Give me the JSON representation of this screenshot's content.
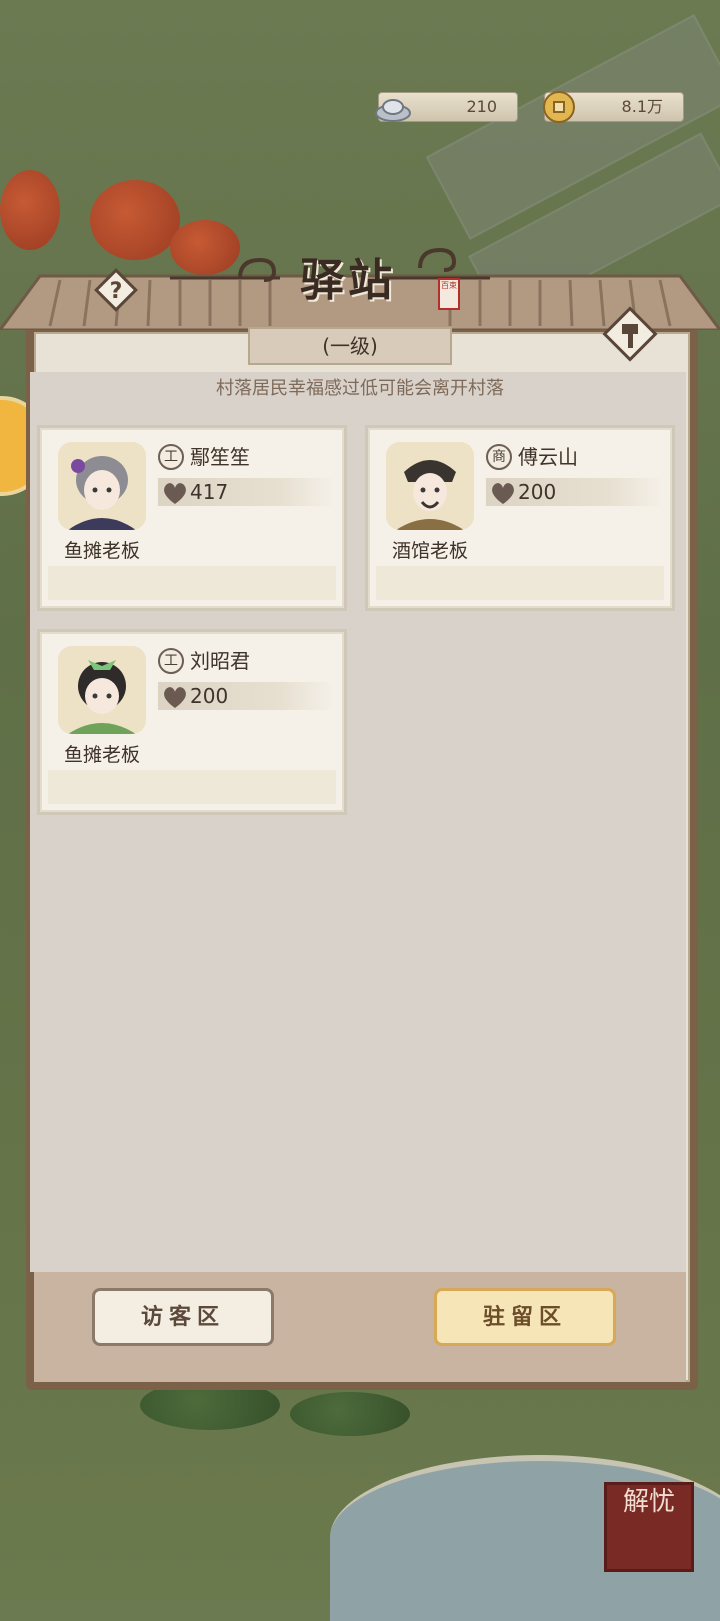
{
  "currency": {
    "silver_amount": "210",
    "coin_amount": "8.1万",
    "silver_icon": "silver-ingot-icon",
    "coin_icon": "copper-coin-icon"
  },
  "panel": {
    "title": "驿站",
    "seal_text": "百束",
    "level": "(一级)",
    "notice": "村落居民幸福感过低可能会离开村落"
  },
  "residents": [
    {
      "role_icon": "工",
      "name": "鄢笙笙",
      "happiness": "417",
      "occupation": "鱼摊老板",
      "avatar": "gray-haired-woman-avatar"
    },
    {
      "role_icon": "商",
      "name": "傅云山",
      "happiness": "200",
      "occupation": "酒馆老板",
      "avatar": "bearded-man-avatar"
    },
    {
      "role_icon": "工",
      "name": "刘昭君",
      "happiness": "200",
      "occupation": "鱼摊老板",
      "avatar": "green-bow-girl-avatar"
    }
  ],
  "tabs": {
    "visitor": "访客区",
    "stay": "驻留区"
  },
  "solve_button": "解忧",
  "colors": {
    "panel_frame": "#7a6147",
    "content_bg": "#d9d2ca",
    "active_tab": "#f6e6b7",
    "seal_red": "#b3302a"
  }
}
